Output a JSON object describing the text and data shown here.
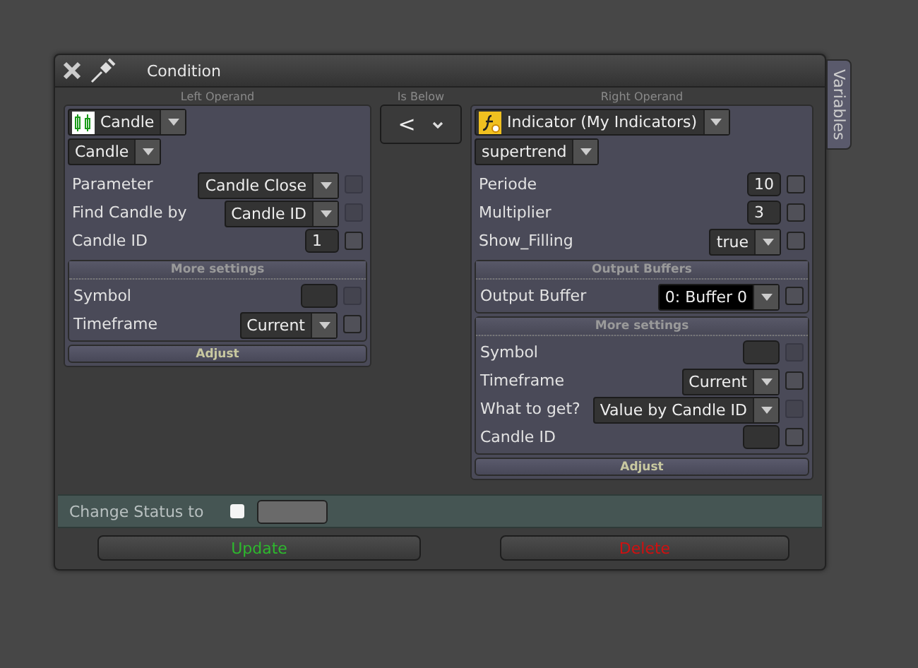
{
  "window": {
    "title": "Condition"
  },
  "side_tab": {
    "label": "Variables"
  },
  "left": {
    "heading": "Left Operand",
    "source": {
      "kind": "candle",
      "label": "Candle"
    },
    "subtype": "Candle",
    "rows": [
      {
        "label": "Parameter",
        "kind": "select",
        "value": "Candle Close",
        "check": {
          "checked": false,
          "disabled": true
        }
      },
      {
        "label": "Find Candle by",
        "kind": "select",
        "value": "Candle ID",
        "check": {
          "checked": false,
          "disabled": true
        }
      },
      {
        "label": "Candle ID",
        "kind": "input",
        "value": "1",
        "check": {
          "checked": false,
          "disabled": false
        }
      }
    ],
    "sections": [
      {
        "title": "More settings",
        "rows": [
          {
            "label": "Symbol",
            "kind": "input",
            "value": "",
            "check": {
              "checked": false,
              "disabled": true
            }
          },
          {
            "label": "Timeframe",
            "kind": "select",
            "value": "Current",
            "check": {
              "checked": false,
              "disabled": false
            }
          }
        ]
      }
    ],
    "adjust": "Adjust"
  },
  "operator": {
    "heading": "Is Below",
    "symbol": "<"
  },
  "right": {
    "heading": "Right Operand",
    "source": {
      "kind": "indicator",
      "label": "Indicator (My Indicators)"
    },
    "subtype": "supertrend",
    "rows": [
      {
        "label": "Periode",
        "kind": "input",
        "value": "10",
        "check": {
          "checked": false,
          "disabled": false
        }
      },
      {
        "label": "Multiplier",
        "kind": "input",
        "value": "3",
        "check": {
          "checked": false,
          "disabled": false
        }
      },
      {
        "label": "Show_Filling",
        "kind": "select",
        "value": "true",
        "check": {
          "checked": false,
          "disabled": false
        }
      }
    ],
    "sections": [
      {
        "title": "Output Buffers",
        "rows": [
          {
            "label": "Output Buffer",
            "kind": "select",
            "value": "0: Buffer 0",
            "focused": true,
            "check": {
              "checked": false,
              "disabled": false
            }
          }
        ]
      },
      {
        "title": "More settings",
        "rows": [
          {
            "label": "Symbol",
            "kind": "input",
            "value": "",
            "check": {
              "checked": false,
              "disabled": true
            }
          },
          {
            "label": "Timeframe",
            "kind": "select",
            "value": "Current",
            "check": {
              "checked": false,
              "disabled": false
            }
          },
          {
            "label": "What to get?",
            "kind": "select",
            "value": "Value by Candle ID",
            "check": {
              "checked": false,
              "disabled": true
            }
          },
          {
            "label": "Candle ID",
            "kind": "input",
            "value": "",
            "check": {
              "checked": false,
              "disabled": false
            }
          }
        ]
      }
    ],
    "adjust": "Adjust"
  },
  "status": {
    "label": "Change Status to",
    "checked": false
  },
  "buttons": [
    {
      "label": "Update",
      "kind": "update"
    },
    {
      "label": "Delete",
      "kind": "delete"
    }
  ]
}
